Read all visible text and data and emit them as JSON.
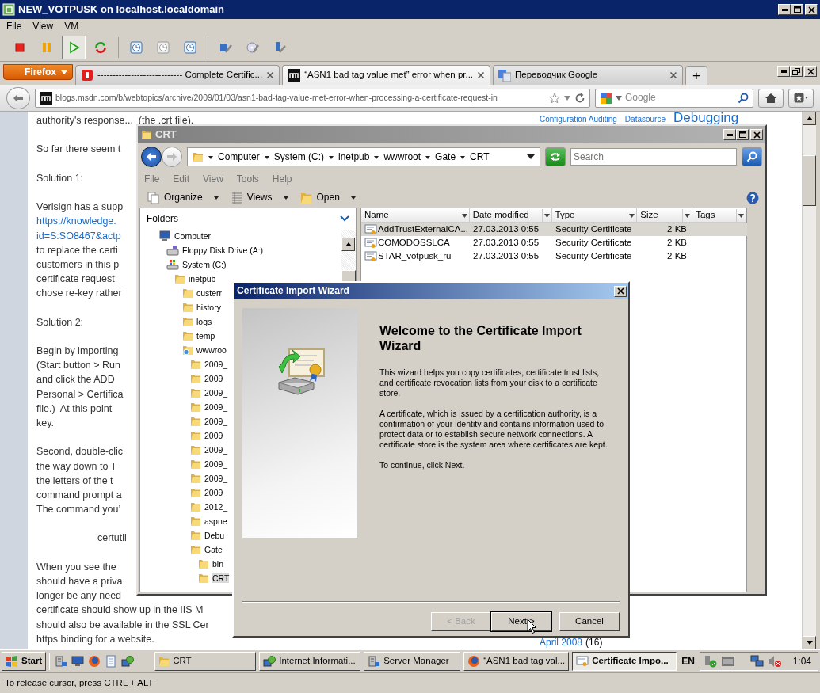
{
  "vm_window": {
    "title": "NEW_VOTPUSK on localhost.localdomain",
    "menu": [
      "File",
      "View",
      "VM"
    ],
    "toolbar": [
      {
        "kind": "stop",
        "pressed": false
      },
      {
        "kind": "pause",
        "pressed": false
      },
      {
        "kind": "play",
        "pressed": true
      },
      {
        "kind": "reset",
        "pressed": false
      },
      {
        "kind": "snapshot",
        "pressed": false
      },
      {
        "kind": "revert",
        "pressed": false
      },
      {
        "kind": "manager",
        "pressed": false
      },
      {
        "kind": "disk-tool",
        "pressed": false
      },
      {
        "kind": "cd-tool",
        "pressed": false
      },
      {
        "kind": "usb-tool",
        "pressed": false
      }
    ]
  },
  "browser": {
    "menu_button": "Firefox",
    "tabs": [
      {
        "title": "---------------------------- Complete Certific...",
        "selected": false
      },
      {
        "title": "“ASN1 bad tag value met” error when pr...",
        "selected": true
      },
      {
        "title": "Переводчик Google",
        "selected": false
      }
    ],
    "new_tab": "+",
    "url": "blogs.msdn.com/b/webtopics/archive/2009/01/03/asn1-bad-tag-value-met-error-when-processing-a-certificate-request-in",
    "search_placeholder": "Google"
  },
  "page": {
    "article": [
      {
        "kind": "text",
        "lines": [
          {
            "text": "authority's response...  (the .crt file).",
            "link": false
          }
        ]
      },
      {
        "kind": "text",
        "lines": [
          {
            "text": "So far there seem t",
            "link": false
          }
        ]
      },
      {
        "kind": "text",
        "lines": [
          {
            "text": "Solution 1:",
            "link": false
          }
        ]
      },
      {
        "kind": "text",
        "lines": [
          {
            "text": "Verisign has a supp",
            "link": false
          },
          {
            "text": "https://knowledge.",
            "link": true
          },
          {
            "text": "id=S:SO8467&actp",
            "link": true
          },
          {
            "text": "to replace the certi",
            "link": false
          },
          {
            "text": "customers in this p",
            "link": false
          },
          {
            "text": "certificate request",
            "link": false
          },
          {
            "text": "chose re-key rather",
            "link": false
          }
        ]
      },
      {
        "kind": "text",
        "lines": [
          {
            "text": "Solution 2:",
            "link": false
          }
        ]
      },
      {
        "kind": "text",
        "lines": [
          {
            "text": "Begin by importing",
            "link": false
          },
          {
            "text": "(Start button > Run",
            "link": false
          },
          {
            "text": "and click the ADD",
            "link": false
          },
          {
            "text": "Personal > Certifica",
            "link": false
          },
          {
            "text": "file.)  At this point",
            "link": false
          },
          {
            "text": "key.",
            "link": false
          }
        ]
      },
      {
        "kind": "text",
        "lines": [
          {
            "text": "Second, double-clic",
            "link": false
          },
          {
            "text": "the way down to T",
            "link": false
          },
          {
            "text": "the letters of the t",
            "link": false
          },
          {
            "text": "command prompt a",
            "link": false
          },
          {
            "text": "The command you’",
            "link": false
          }
        ]
      },
      {
        "kind": "command",
        "lines": [
          {
            "text": "certutil",
            "link": false
          }
        ]
      },
      {
        "kind": "text",
        "lines": [
          {
            "text": "When you see the",
            "link": false
          },
          {
            "text": "should have a priva",
            "link": false
          },
          {
            "text": "longer be any need",
            "link": false
          },
          {
            "text": "certificate should show up in the IIS M",
            "link": false
          },
          {
            "text": "should also be available in the SSL Cer",
            "link": false
          },
          {
            "text": "https binding for a website.",
            "link": false
          }
        ]
      }
    ],
    "tags": [
      {
        "label": "Configuration Auditing",
        "kind": "minor"
      },
      {
        "label": "Datasource",
        "kind": "minor"
      },
      {
        "label": "Debugging",
        "kind": "major"
      }
    ],
    "archive": {
      "month": "April 2008",
      "count": "(16)"
    }
  },
  "explorer": {
    "title": "CRT",
    "breadcrumb": [
      "Computer",
      "System (C:)",
      "inetpub",
      "wwwroot",
      "Gate",
      "CRT"
    ],
    "search_placeholder": "Search",
    "menu": [
      "File",
      "Edit",
      "View",
      "Tools",
      "Help"
    ],
    "toolbar": [
      {
        "label": "Organize",
        "kind": "organize"
      },
      {
        "label": "Views",
        "kind": "views"
      },
      {
        "label": "Open",
        "kind": "open"
      }
    ],
    "folders_label": "Folders",
    "tree": [
      {
        "label": "Computer",
        "kind": "computer",
        "selected": false,
        "children": [
          {
            "label": "Floppy Disk Drive (A:)",
            "kind": "floppy",
            "selected": false
          },
          {
            "label": "System (C:)",
            "kind": "drive",
            "selected": false,
            "children": [
              {
                "label": "inetpub",
                "kind": "folder",
                "selected": false,
                "children": [
                  {
                    "label": "custerr",
                    "kind": "folder",
                    "selected": false
                  },
                  {
                    "label": "history",
                    "kind": "folder",
                    "selected": false
                  },
                  {
                    "label": "logs",
                    "kind": "folder",
                    "selected": false
                  },
                  {
                    "label": "temp",
                    "kind": "folder",
                    "selected": false
                  },
                  {
                    "label": "wwwroo",
                    "kind": "web-folder",
                    "selected": false,
                    "children": [
                      {
                        "label": "2009_",
                        "kind": "folder",
                        "selected": false
                      },
                      {
                        "label": "2009_",
                        "kind": "folder",
                        "selected": false
                      },
                      {
                        "label": "2009_",
                        "kind": "folder",
                        "selected": false
                      },
                      {
                        "label": "2009_",
                        "kind": "folder",
                        "selected": false
                      },
                      {
                        "label": "2009_",
                        "kind": "folder",
                        "selected": false
                      },
                      {
                        "label": "2009_",
                        "kind": "folder",
                        "selected": false
                      },
                      {
                        "label": "2009_",
                        "kind": "folder",
                        "selected": false
                      },
                      {
                        "label": "2009_",
                        "kind": "folder",
                        "selected": false
                      },
                      {
                        "label": "2009_",
                        "kind": "folder",
                        "selected": false
                      },
                      {
                        "label": "2009_",
                        "kind": "folder",
                        "selected": false
                      },
                      {
                        "label": "2012_",
                        "kind": "folder",
                        "selected": false
                      },
                      {
                        "label": "aspne",
                        "kind": "folder",
                        "selected": false
                      },
                      {
                        "label": "Debu",
                        "kind": "folder",
                        "selected": false
                      },
                      {
                        "label": "Gate",
                        "kind": "folder",
                        "selected": false,
                        "children": [
                          {
                            "label": "bin",
                            "kind": "folder",
                            "selected": false
                          },
                          {
                            "label": "CRT",
                            "kind": "folder",
                            "selected": true
                          }
                        ]
                      }
                    ]
                  }
                ]
              }
            ]
          }
        ]
      }
    ],
    "columns": [
      "Name",
      "Date modified",
      "Type",
      "Size",
      "Tags"
    ],
    "files": [
      {
        "name": "AddTrustExternalCA...",
        "date": "27.03.2013 0:55",
        "type": "Security Certificate",
        "size": "2 KB",
        "selected": true
      },
      {
        "name": "COMODOSSLCA",
        "date": "27.03.2013 0:55",
        "type": "Security Certificate",
        "size": "2 KB",
        "selected": false
      },
      {
        "name": "STAR_votpusk_ru",
        "date": "27.03.2013 0:55",
        "type": "Security Certificate",
        "size": "2 KB",
        "selected": false
      }
    ]
  },
  "wizard": {
    "title": "Certificate Import Wizard",
    "heading": "Welcome to the Certificate Import Wizard",
    "paragraphs": [
      "This wizard helps you copy certificates, certificate trust lists, and certificate revocation lists from your disk to a certificate store.",
      "A certificate, which is issued by a certification authority, is a confirmation of your identity and contains information used to protect data or to establish secure network connections. A certificate store is the system area where certificates are kept.",
      "To continue, click Next."
    ],
    "buttons": [
      {
        "label": "< Back",
        "disabled": true,
        "default": false
      },
      {
        "label": "Next >",
        "disabled": false,
        "default": true
      },
      {
        "label": "Cancel",
        "disabled": false,
        "default": false
      }
    ]
  },
  "taskbar": {
    "start": "Start",
    "tasks": [
      {
        "label": "CRT",
        "selected": false
      },
      {
        "label": "Internet Informati...",
        "selected": false
      },
      {
        "label": "Server Manager",
        "selected": false
      },
      {
        "label": "“ASN1 bad tag val...",
        "selected": false
      },
      {
        "label": "Certificate Impo...",
        "selected": true
      }
    ],
    "language": "EN",
    "clock": "1:04"
  },
  "status_bar": "To release cursor, press CTRL + ALT"
}
